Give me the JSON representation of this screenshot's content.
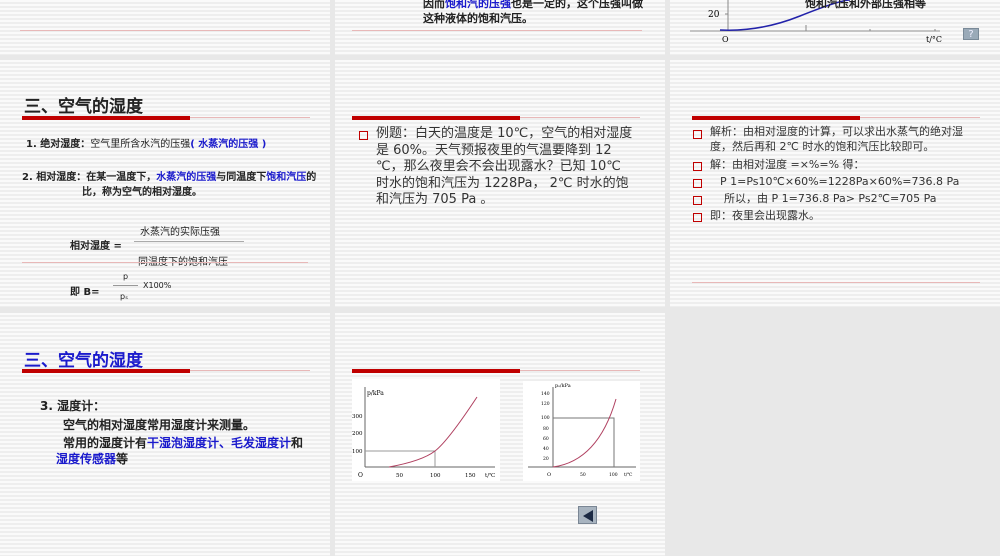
{
  "slide_top_middle": {
    "line1_pre": "因而",
    "line1_blue": "饱和汽的压强",
    "line1_post": "也是一定的，这个压强叫做",
    "line2": "这种液体的饱和汽压。"
  },
  "slide_top_right": {
    "caption": "饱和汽压和外部压强相等",
    "y_tick": "20",
    "origin": "O",
    "x_label": "t/°C",
    "help_button": "?"
  },
  "slide_humidity_def": {
    "title": "三、空气的湿度",
    "abs_label": "1. 绝对湿度：",
    "abs_text": "空气里所含水汽的压强",
    "abs_blue": "( 水蒸汽的压强 )",
    "rel_label": "2. 相对湿度：",
    "rel_pre": "在某一温度下，",
    "rel_blue1": "水蒸汽的压强",
    "rel_mid": "与同温度下",
    "rel_blue2": "饱和汽压",
    "rel_post": "的比，称为空气的相对湿度。",
    "formula_label": "相对湿度 =",
    "numerator": "水蒸汽的实际压强",
    "denominator": "同温度下的饱和汽压",
    "b_label": "即 B=",
    "b_num": "p",
    "b_den": "pₛ",
    "b_mult": "X100%"
  },
  "slide_example": {
    "text": "例题：白天的温度是 10℃，空气的相对湿度是 60%。天气预报夜里的气温要降到 12 ℃，那么夜里会不会出现露水？已知 10℃ 时水的饱和汽压为 1228Pa， 2℃ 时水的饱和汽压为 705 Pa 。"
  },
  "slide_solution": {
    "bullets": [
      "解析：由相对湿度的计算，可以求出水蒸气的绝对湿度，然后再和 2℃ 时水的饱和汽压比较即可。",
      "解：由相对湿度 =×%=% 得：",
      "P 1=Ps10℃×60%=1228Pa×60%=736.8 Pa",
      "所以，由 P 1=736.8 Pa> Ps2℃=705 Pa",
      "即：夜里会出现露水。"
    ]
  },
  "slide_hygrometer": {
    "title": "三、空气的湿度",
    "heading": "3. 湿度计：",
    "line1": "空气的相对湿度常用湿度计来测量。",
    "line2_pre": "常用的湿度计有",
    "line2_blue1": "干湿泡湿度计、毛发湿度计",
    "line2_mid": "和",
    "line2_blue2": "湿度传感器",
    "line2_post": "等"
  },
  "slide_graphs": {
    "chart1": {
      "ylabel": "p/kPa",
      "yticks": [
        "300",
        "200",
        "100"
      ],
      "xticks": [
        "50",
        "100",
        "150"
      ],
      "origin": "O",
      "xlabel": "t/℃"
    },
    "chart2": {
      "ylabel": "pₛ/kPa",
      "yticks": [
        "140",
        "120",
        "100",
        "80",
        "60",
        "40",
        "20"
      ],
      "xticks": [
        "50",
        "100"
      ],
      "origin": "O",
      "xlabel": "t/℃"
    },
    "back_button": "previous-slide"
  },
  "colors": {
    "accent_red": "#c00000",
    "link_blue": "#1a1acc",
    "background": "#e8e8e8"
  }
}
